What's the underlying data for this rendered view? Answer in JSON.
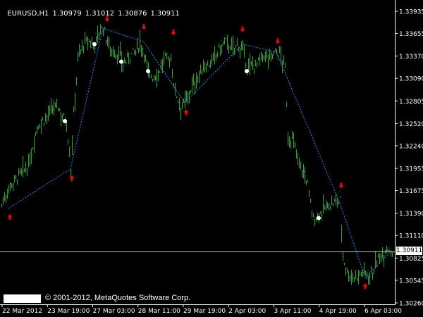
{
  "header": {
    "symbol": "EURUSD,H1",
    "open": "1.30979",
    "high": "1.31012",
    "low": "1.30876",
    "close": "1.30911"
  },
  "copyright": "© 2001-2012, MetaQuotes Software Corp.",
  "current_price": "1.30911",
  "colors": {
    "background": "#000000",
    "bars": "#2E9E2E",
    "zigzag": "#1E90FF",
    "up_arrow": "#FF0000",
    "down_arrow": "#FF0000",
    "dots": "#FFFFFF",
    "axis": "#FFFFFF"
  },
  "chart_data": {
    "type": "ohlc",
    "y_axis_labels": [
      "1.33935",
      "1.33655",
      "1.33370",
      "1.33090",
      "1.32805",
      "1.32520",
      "1.32240",
      "1.31955",
      "1.31675",
      "1.31390",
      "1.31110",
      "1.30825",
      "1.30545",
      "1.30260"
    ],
    "x_axis_labels": [
      "22 Mar 2012",
      "23 Mar 19:00",
      "27 Mar 03:00",
      "28 Mar 11:00",
      "29 Mar 19:00",
      "2 Apr 03:00",
      "3 Apr 11:00",
      "4 Apr 19:00",
      "6 Apr 03:00"
    ],
    "ylim": [
      1.3026,
      1.33935
    ],
    "current_price": 1.30911,
    "price_path": [
      [
        0,
        1.3145
      ],
      [
        12,
        1.3172
      ],
      [
        25,
        1.3185
      ],
      [
        40,
        1.3198
      ],
      [
        52,
        1.3248
      ],
      [
        60,
        1.3255
      ],
      [
        70,
        1.3265
      ],
      [
        80,
        1.3275
      ],
      [
        88,
        1.3262
      ],
      [
        94,
        1.3255
      ],
      [
        100,
        1.3195
      ],
      [
        104,
        1.3262
      ],
      [
        110,
        1.3335
      ],
      [
        118,
        1.3352
      ],
      [
        126,
        1.3355
      ],
      [
        134,
        1.3352
      ],
      [
        140,
        1.3368
      ],
      [
        146,
        1.3372
      ],
      [
        152,
        1.3355
      ],
      [
        160,
        1.3342
      ],
      [
        168,
        1.3338
      ],
      [
        176,
        1.3328
      ],
      [
        184,
        1.3338
      ],
      [
        192,
        1.3342
      ],
      [
        198,
        1.3355
      ],
      [
        204,
        1.3342
      ],
      [
        210,
        1.3315
      ],
      [
        218,
        1.331
      ],
      [
        226,
        1.332
      ],
      [
        234,
        1.3335
      ],
      [
        242,
        1.3332
      ],
      [
        248,
        1.3292
      ],
      [
        256,
        1.3275
      ],
      [
        262,
        1.3278
      ],
      [
        270,
        1.3295
      ],
      [
        280,
        1.331
      ],
      [
        290,
        1.3325
      ],
      [
        300,
        1.3328
      ],
      [
        310,
        1.3345
      ],
      [
        320,
        1.3355
      ],
      [
        330,
        1.3345
      ],
      [
        338,
        1.3352
      ],
      [
        344,
        1.3342
      ],
      [
        350,
        1.3322
      ],
      [
        358,
        1.3325
      ],
      [
        366,
        1.3328
      ],
      [
        374,
        1.3338
      ],
      [
        382,
        1.3335
      ],
      [
        390,
        1.3342
      ],
      [
        398,
        1.3338
      ],
      [
        404,
        1.332
      ],
      [
        408,
        1.3235
      ],
      [
        414,
        1.3232
      ],
      [
        420,
        1.3215
      ],
      [
        428,
        1.3195
      ],
      [
        436,
        1.3175
      ],
      [
        444,
        1.313
      ],
      [
        452,
        1.3138
      ],
      [
        460,
        1.3145
      ],
      [
        468,
        1.315
      ],
      [
        476,
        1.3152
      ],
      [
        482,
        1.3155
      ],
      [
        486,
        1.3085
      ],
      [
        492,
        1.3065
      ],
      [
        500,
        1.3058
      ],
      [
        508,
        1.3062
      ],
      [
        516,
        1.3065
      ],
      [
        524,
        1.3062
      ],
      [
        532,
        1.3072
      ],
      [
        540,
        1.3088
      ],
      [
        548,
        1.3095
      ],
      [
        556,
        1.3092
      ]
    ],
    "zigzag": [
      [
        12,
        1.3145
      ],
      [
        100,
        1.3195
      ],
      [
        146,
        1.3372
      ],
      [
        204,
        1.3355
      ],
      [
        262,
        1.3278
      ],
      [
        344,
        1.3352
      ],
      [
        392,
        1.3342
      ],
      [
        482,
        1.3152
      ],
      [
        518,
        1.3058
      ],
      [
        556,
        1.3092
      ]
    ],
    "up_arrows": [
      [
        14,
        1.3143
      ],
      [
        102,
        1.3192
      ],
      [
        264,
        1.3275
      ],
      [
        518,
        1.3056
      ]
    ],
    "down_arrows": [
      [
        152,
        1.3375
      ],
      [
        204,
        1.3365
      ],
      [
        246,
        1.3358
      ],
      [
        344,
        1.3362
      ],
      [
        394,
        1.3347
      ],
      [
        484,
        1.3165
      ]
    ],
    "dots": [
      [
        92,
        1.3255
      ],
      [
        134,
        1.3352
      ],
      [
        172,
        1.333
      ],
      [
        210,
        1.3318
      ],
      [
        350,
        1.3318
      ],
      [
        452,
        1.3133
      ]
    ]
  }
}
